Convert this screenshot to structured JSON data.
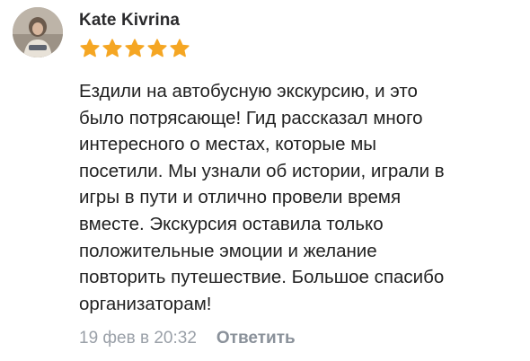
{
  "review": {
    "author": "Kate Kivrina",
    "rating": 5,
    "rating_max": 5,
    "star_color": "#f5a623",
    "text_lines": [
      "Ездили на автобусную экскурсию, и это",
      "было потрясающе! Гид рассказал много",
      "интересного о местах, которые мы",
      "посетили. Мы узнали об истории, играли в",
      "игры в пути и отлично провели время",
      "вместе. Экскурсия оставила только",
      "положительные эмоции и желание",
      "повторить путешествие. Большое спасибо",
      "организаторам!"
    ],
    "timestamp": "19 фев в 20:32",
    "reply_label": "Ответить"
  },
  "icons": {
    "avatar": "user-photo",
    "star": "star-icon"
  }
}
